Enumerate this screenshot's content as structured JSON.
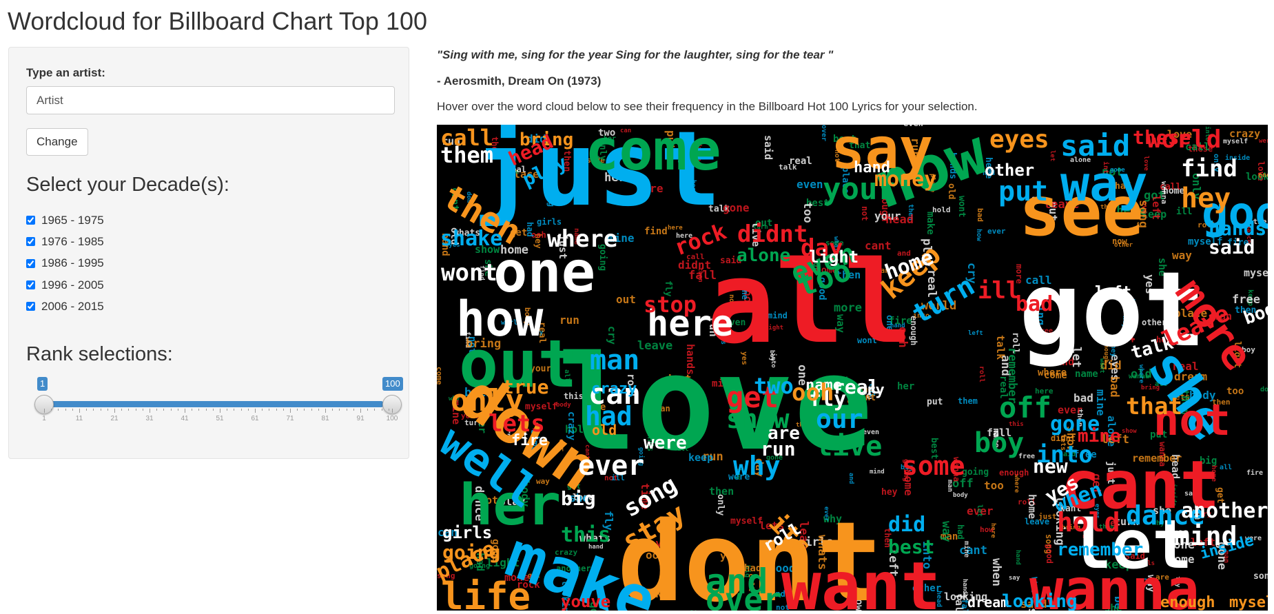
{
  "page": {
    "title": "Wordcloud for Billboard Chart Top 100"
  },
  "sidebar": {
    "artist_label": "Type an artist:",
    "artist_placeholder": "Artist",
    "change_button": "Change",
    "decades_heading": "Select your Decade(s):",
    "decades": [
      {
        "label": "1965 - 1975",
        "checked": true
      },
      {
        "label": "1976 - 1985",
        "checked": true
      },
      {
        "label": "1986 - 1995",
        "checked": true
      },
      {
        "label": "1996 - 2005",
        "checked": true
      },
      {
        "label": "2006 - 2015",
        "checked": true
      }
    ],
    "rank_heading": "Rank selections:",
    "rank_slider": {
      "min": 1,
      "max": 100,
      "from": 1,
      "to": 100,
      "from_label": "1",
      "to_label": "100",
      "tick_labels": [
        "1",
        "11",
        "21",
        "31",
        "41",
        "51",
        "61",
        "71",
        "81",
        "91",
        "100"
      ],
      "accent": "#428bca"
    }
  },
  "main": {
    "quote": "\"Sing with me, sing for the year Sing for the laughter, sing for the tear \"",
    "attribution": "- Aerosmith, Dream On (1973)",
    "hover_note": "Hover over the word cloud below to see their frequency in the Billboard Hot 100 Lyrics for your selection."
  },
  "wordcloud": {
    "background": "#000000",
    "palette": {
      "blue": "#00aeef",
      "red": "#ee1c25",
      "green": "#00a651",
      "orange": "#f7941d",
      "white": "#ffffff"
    },
    "words": [
      "love",
      "dont",
      "all",
      "just",
      "got",
      "come",
      "now",
      "say",
      "see",
      "way",
      "one",
      "how",
      "out",
      "down",
      "make",
      "want",
      "wanna",
      "cant",
      "let",
      "her",
      "well",
      "life",
      "where",
      "here",
      "she",
      "more",
      "good",
      "said",
      "world",
      "eyes",
      "find",
      "hey",
      "keep",
      "your",
      "day",
      "home",
      "turn",
      "off",
      "boy",
      "ever",
      "can",
      "only",
      "lets",
      "had",
      "man",
      "get",
      "show",
      "our",
      "live",
      "why",
      "some",
      "time",
      "into",
      "gone",
      "not",
      "that",
      "hold",
      "dance",
      "mind",
      "another",
      "remember",
      "inside",
      "when",
      "did",
      "best",
      "and",
      "over",
      "stay",
      "song",
      "its",
      "roll",
      "this",
      "going",
      "girls",
      "place",
      "youve",
      "dream",
      "looking",
      "enough",
      "myself",
      "whats",
      "then",
      "shake",
      "them",
      "call",
      "bring",
      "head",
      "play",
      "put",
      "rock",
      "stop",
      "alone",
      "even",
      "too",
      "bad",
      "ill",
      "left",
      "talk",
      "body",
      "leave",
      "yes",
      "new",
      "mine",
      "are",
      "run",
      "real",
      "name",
      "cry",
      "fly",
      "two",
      "ooh",
      "true",
      "fire",
      "old",
      "crazy",
      "were",
      "big",
      "wont",
      "these",
      "other",
      "hand",
      "money",
      "said",
      "hands",
      "light",
      "didnt",
      "fall",
      "free"
    ]
  }
}
